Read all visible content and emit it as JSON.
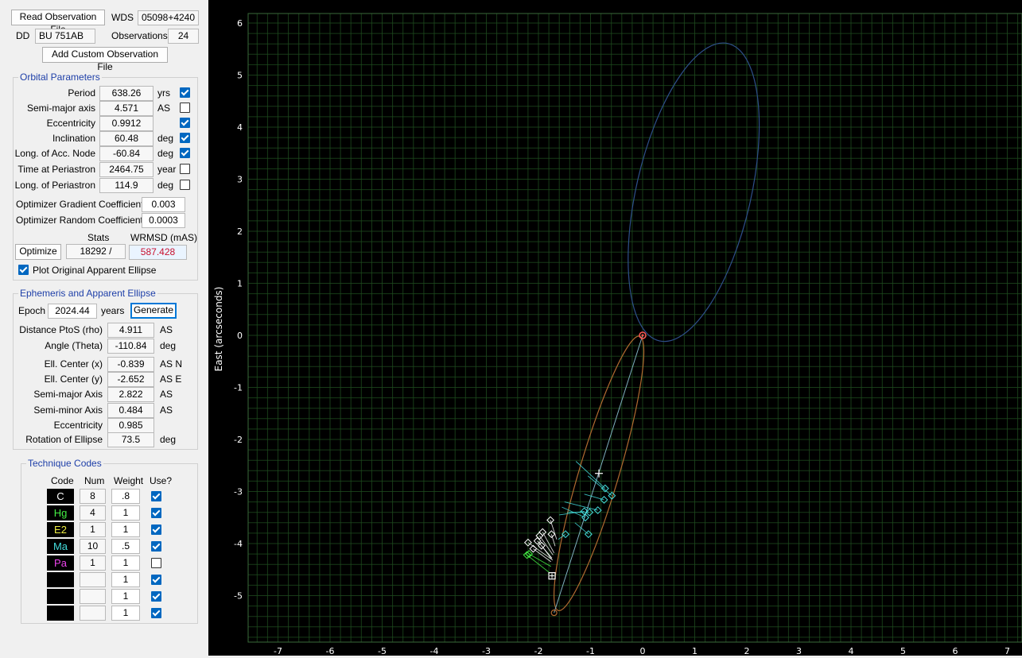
{
  "top": {
    "read_button": "Read Observation File",
    "wds_label": "WDS",
    "wds_value": "05098+4240",
    "dd_label": "DD",
    "dd_value": "BU 751AB",
    "obs_label": "Observations",
    "obs_value": "24",
    "add_button": "Add Custom Observation File"
  },
  "orbital": {
    "title": "Orbital Parameters",
    "params": [
      {
        "label": "Period",
        "value": "638.26",
        "unit": "yrs",
        "checked": true
      },
      {
        "label": "Semi-major axis",
        "value": "4.571",
        "unit": "AS",
        "checked": false
      },
      {
        "label": "Eccentricity",
        "value": "0.9912",
        "unit": "",
        "checked": true
      },
      {
        "label": "Inclination",
        "value": "60.48",
        "unit": "deg",
        "checked": true
      },
      {
        "label": "Long. of Acc. Node",
        "value": "-60.84",
        "unit": "deg",
        "checked": true
      },
      {
        "label": "Time at Periastron",
        "value": "2464.75",
        "unit": "year",
        "checked": false
      },
      {
        "label": "Long. of Periastron",
        "value": "114.9",
        "unit": "deg",
        "checked": false
      }
    ],
    "grad_label": "Optimizer Gradient Coefficient",
    "grad_value": "0.003",
    "rand_label": "Optimizer Random Coefficient",
    "rand_value": "0.0003",
    "stats_label": "Stats",
    "wrmsd_label": "WRMSD (mAS)",
    "optimize_button": "Optimize",
    "stats_value": "18292 /",
    "wrmsd_value": "587.428",
    "plot_original_label": "Plot Original Apparent Ellipse",
    "plot_original_checked": true
  },
  "ephem": {
    "title": "Ephemeris and Apparent Ellipse",
    "epoch_label": "Epoch",
    "epoch_value": "2024.44",
    "years_label": "years",
    "generate_button": "Generate",
    "rows": [
      {
        "label": "Distance PtoS (rho)",
        "value": "4.911",
        "unit": "AS"
      },
      {
        "label": "Angle (Theta)",
        "value": "-110.84",
        "unit": "deg"
      },
      {
        "label": "Ell. Center (x)",
        "value": "-0.839",
        "unit": "AS N"
      },
      {
        "label": "Ell. Center (y)",
        "value": "-2.652",
        "unit": "AS E"
      },
      {
        "label": "Semi-major Axis",
        "value": "2.822",
        "unit": "AS"
      },
      {
        "label": "Semi-minor Axis",
        "value": "0.484",
        "unit": "AS"
      },
      {
        "label": "Eccentricity",
        "value": "0.985",
        "unit": ""
      },
      {
        "label": "Rotation of Ellipse",
        "value": "73.5",
        "unit": "deg"
      }
    ]
  },
  "technique": {
    "title": "Technique Codes",
    "headers": [
      "Code",
      "Num",
      "Weight",
      "Use?"
    ],
    "rows": [
      {
        "code": "C",
        "color": "#ffffff",
        "num": "8",
        "weight": ".8",
        "use": true
      },
      {
        "code": "Hg",
        "color": "#44ee44",
        "num": "4",
        "weight": "1",
        "use": true
      },
      {
        "code": "E2",
        "color": "#eeee44",
        "num": "1",
        "weight": "1",
        "use": true
      },
      {
        "code": "Ma",
        "color": "#44dddd",
        "num": "10",
        "weight": ".5",
        "use": true
      },
      {
        "code": "Pa",
        "color": "#ee44ee",
        "num": "1",
        "weight": "1",
        "use": false
      },
      {
        "code": "",
        "color": "#ffffff",
        "num": "",
        "weight": "1",
        "use": true
      },
      {
        "code": "",
        "color": "#ffffff",
        "num": "",
        "weight": "1",
        "use": true
      },
      {
        "code": "",
        "color": "#ffffff",
        "num": "",
        "weight": "1",
        "use": true
      }
    ]
  },
  "plot": {
    "ylabel": "East (arcseconds)",
    "x_ticks": [
      "-7",
      "-6",
      "-5",
      "-4",
      "-3",
      "-2",
      "-1",
      "0",
      "1",
      "2",
      "3",
      "4",
      "5",
      "6",
      "7"
    ],
    "y_ticks": [
      "6",
      "5",
      "4",
      "3",
      "2",
      "1",
      "0",
      "-1",
      "-2",
      "-3",
      "-4",
      "-5"
    ],
    "colors": {
      "grid": "#1e4a1e",
      "axis_text": "#ffffff",
      "original_ellipse": "#2e4f8a",
      "apparent_ellipse": "#b06a30",
      "primary": "#ff5555"
    }
  }
}
